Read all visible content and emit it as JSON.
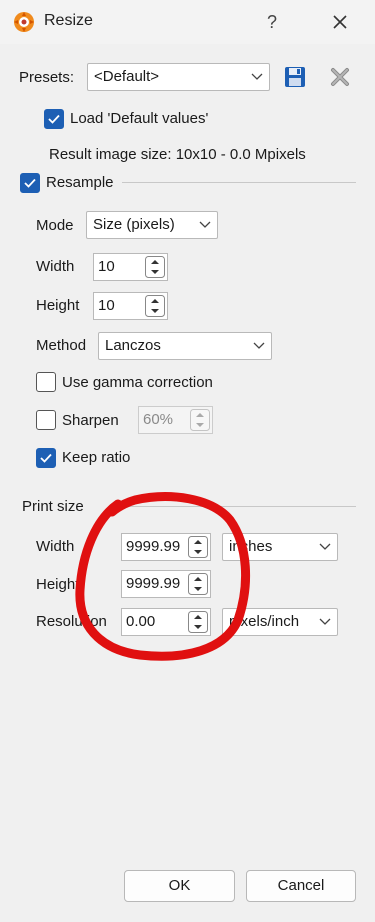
{
  "window": {
    "title": "Resize",
    "help": "?"
  },
  "presets": {
    "label": "Presets:",
    "value": "<Default>"
  },
  "load_defaults": {
    "label": "Load 'Default values'",
    "checked": true
  },
  "result_size": "Result image size: 10x10 - 0.0 Mpixels",
  "resample": {
    "label": "Resample",
    "checked": true,
    "mode": {
      "label": "Mode",
      "value": "Size (pixels)"
    },
    "width": {
      "label": "Width",
      "value": "10"
    },
    "height": {
      "label": "Height",
      "value": "10"
    },
    "method": {
      "label": "Method",
      "value": "Lanczos"
    },
    "gamma": {
      "label": "Use gamma correction",
      "checked": false
    },
    "sharpen": {
      "label": "Sharpen",
      "value": "60%",
      "checked": false
    },
    "keep_ratio": {
      "label": "Keep ratio",
      "checked": true
    }
  },
  "print_size": {
    "label": "Print size",
    "width": {
      "label": "Width",
      "value": "9999.99",
      "unit": "inches"
    },
    "height": {
      "label": "Height",
      "value": "9999.99"
    },
    "resolution": {
      "label": "Resolution",
      "value": "0.00",
      "unit": "pixels/inch"
    }
  },
  "buttons": {
    "ok": "OK",
    "cancel": "Cancel"
  },
  "colors": {
    "accent": "#1d5fb4",
    "annotation": "#e01010",
    "save_icon": "#1d5fb4"
  }
}
